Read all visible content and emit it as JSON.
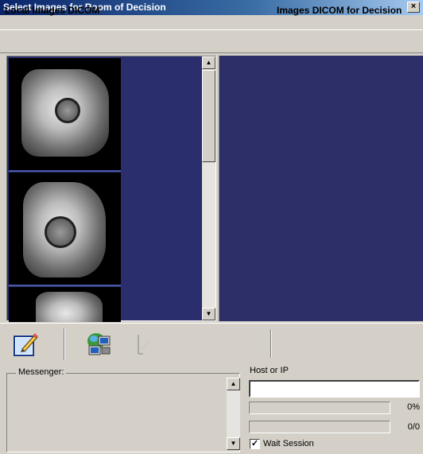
{
  "window": {
    "title": "Select Images for Room of Decision",
    "close_glyph": "×"
  },
  "header": {
    "left_label": "Local Images DICOM",
    "right_label": "Images DICOM for Decision"
  },
  "local_images": {
    "count_visible": 3,
    "items": [
      {
        "name": "thumbnail-1"
      },
      {
        "name": "thumbnail-2"
      },
      {
        "name": "thumbnail-3"
      }
    ]
  },
  "scrollbar": {
    "up_glyph": "▲",
    "down_glyph": "▼"
  },
  "toolbar": {
    "icons": [
      "edit-document-icon",
      "network-computers-icon",
      "disabled-connect-icon"
    ]
  },
  "messenger": {
    "label": "Messenger:",
    "content": "",
    "up_glyph": "▲",
    "down_glyph": "▼"
  },
  "host": {
    "label": "Host or IP",
    "value": "",
    "progress_label": "0%",
    "progress_fraction": 0,
    "count_label": "0/0",
    "count_fraction": 0,
    "wait_session_label": "Wait Session",
    "wait_session_checked": true,
    "check_glyph": "✓"
  },
  "colors": {
    "titlebar": "#0a246a",
    "pane_background": "#2d3068",
    "window_bg": "#d4d0c8"
  }
}
